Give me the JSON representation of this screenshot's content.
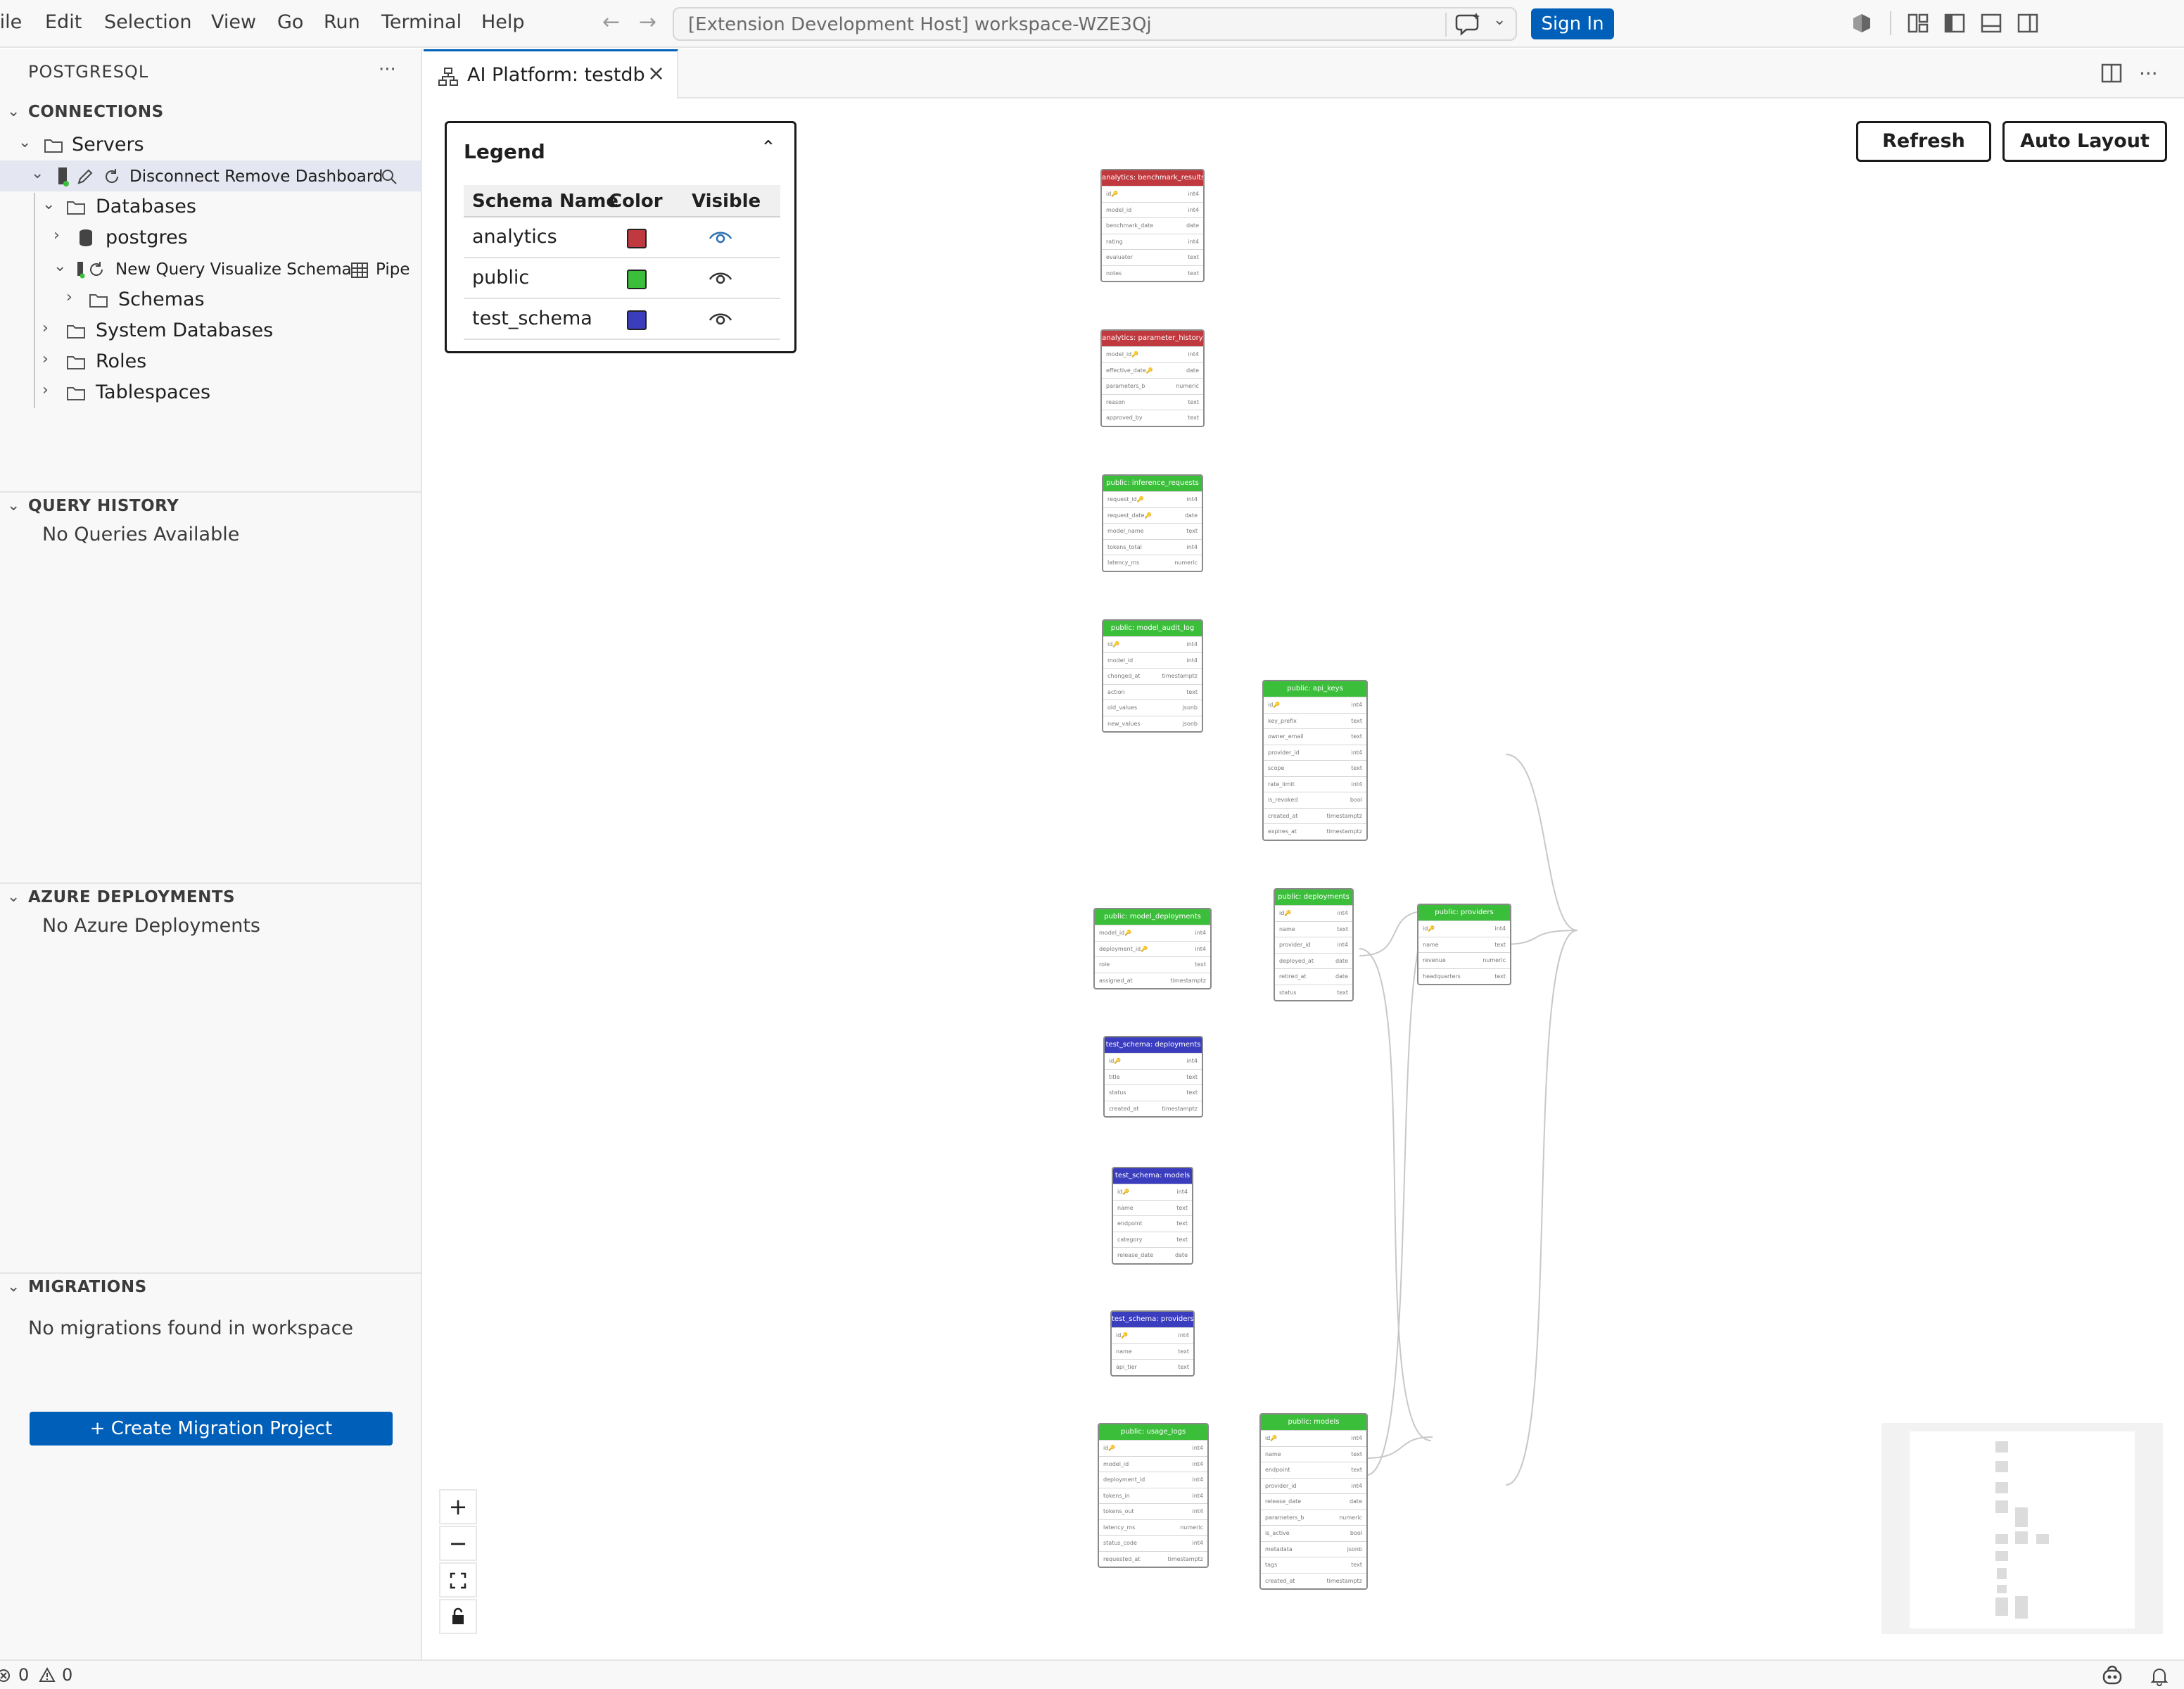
{
  "menu": [
    "File",
    "Edit",
    "Selection",
    "View",
    "Go",
    "Run",
    "Terminal",
    "Help"
  ],
  "command_center": {
    "title": "[Extension Development Host] workspace-WZE3Qj"
  },
  "sign_in": "Sign In",
  "sidebar": {
    "title": "POSTGRESQL",
    "connections": {
      "header": "CONNECTIONS",
      "servers": "Servers",
      "server_actions": "Disconnect Remove Dashboard",
      "databases": "Databases",
      "postgres": "postgres",
      "db_actions": "New Query Visualize Schema",
      "db_actions_more": "Pipe",
      "schemas": "Schemas",
      "system_databases": "System Databases",
      "roles": "Roles",
      "tablespaces": "Tablespaces"
    },
    "query_history": {
      "header": "QUERY HISTORY",
      "empty": "No Queries Available"
    },
    "azure": {
      "header": "AZURE DEPLOYMENTS",
      "empty": "No Azure Deployments"
    },
    "migrations": {
      "header": "MIGRATIONS",
      "empty": "No migrations found in workspace",
      "create": "+ Create Migration Project"
    }
  },
  "tab": {
    "label": "AI Platform: testdb"
  },
  "canvas": {
    "refresh": "Refresh",
    "auto_layout": "Auto Layout"
  },
  "legend": {
    "title": "Legend",
    "headers": {
      "name": "Schema Name",
      "color": "Color",
      "visible": "Visible"
    },
    "rows": [
      {
        "name": "analytics",
        "color": "#c0393f",
        "visible": true
      },
      {
        "name": "public",
        "color": "#3bbf3b",
        "visible": true
      },
      {
        "name": "test_schema",
        "color": "#3b3dbf",
        "visible": true
      }
    ]
  },
  "tables": [
    {
      "title": "analytics: benchmark_results",
      "schema": "analytics",
      "cols": [
        [
          "id🔑",
          "int4"
        ],
        [
          "model_id",
          "int4"
        ],
        [
          "benchmark_date",
          "date"
        ],
        [
          "rating",
          "int4"
        ],
        [
          "evaluator",
          "text"
        ],
        [
          "notes",
          "text"
        ]
      ]
    },
    {
      "title": "analytics: parameter_history",
      "schema": "analytics",
      "cols": [
        [
          "model_id🔑",
          "int4"
        ],
        [
          "effective_date🔑",
          "date"
        ],
        [
          "parameters_b",
          "numeric"
        ],
        [
          "reason",
          "text"
        ],
        [
          "approved_by",
          "text"
        ]
      ]
    },
    {
      "title": "public: inference_requests",
      "schema": "public",
      "cols": [
        [
          "request_id🔑",
          "int4"
        ],
        [
          "request_date🔑",
          "date"
        ],
        [
          "model_name",
          "text"
        ],
        [
          "tokens_total",
          "int4"
        ],
        [
          "latency_ms",
          "numeric"
        ]
      ]
    },
    {
      "title": "public: model_audit_log",
      "schema": "public",
      "cols": [
        [
          "id🔑",
          "int4"
        ],
        [
          "model_id",
          "int4"
        ],
        [
          "changed_at",
          "timestamptz"
        ],
        [
          "action",
          "text"
        ],
        [
          "old_values",
          "jsonb"
        ],
        [
          "new_values",
          "jsonb"
        ]
      ]
    },
    {
      "title": "public: api_keys",
      "schema": "public",
      "cols": [
        [
          "id🔑",
          "int4"
        ],
        [
          "key_prefix",
          "text"
        ],
        [
          "owner_email",
          "text"
        ],
        [
          "provider_id",
          "int4"
        ],
        [
          "scope",
          "text"
        ],
        [
          "rate_limit",
          "int4"
        ],
        [
          "is_revoked",
          "bool"
        ],
        [
          "created_at",
          "timestamptz"
        ],
        [
          "expires_at",
          "timestamptz"
        ]
      ]
    },
    {
      "title": "public: deployments",
      "schema": "public",
      "cols": [
        [
          "id🔑",
          "int4"
        ],
        [
          "name",
          "text"
        ],
        [
          "provider_id",
          "int4"
        ],
        [
          "deployed_at",
          "date"
        ],
        [
          "retired_at",
          "date"
        ],
        [
          "status",
          "text"
        ]
      ]
    },
    {
      "title": "public: providers",
      "schema": "public",
      "cols": [
        [
          "id🔑",
          "int4"
        ],
        [
          "name",
          "text"
        ],
        [
          "revenue",
          "numeric"
        ],
        [
          "headquarters",
          "text"
        ]
      ]
    },
    {
      "title": "public: model_deployments",
      "schema": "public",
      "cols": [
        [
          "model_id🔑",
          "int4"
        ],
        [
          "deployment_id🔑",
          "int4"
        ],
        [
          "role",
          "text"
        ],
        [
          "assigned_at",
          "timestamptz"
        ]
      ]
    },
    {
      "title": "test_schema: deployments",
      "schema": "test_schema",
      "cols": [
        [
          "id🔑",
          "int4"
        ],
        [
          "title",
          "text"
        ],
        [
          "status",
          "text"
        ],
        [
          "created_at",
          "timestamptz"
        ]
      ]
    },
    {
      "title": "test_schema: models",
      "schema": "test_schema",
      "cols": [
        [
          "id🔑",
          "int4"
        ],
        [
          "name",
          "text"
        ],
        [
          "endpoint",
          "text"
        ],
        [
          "category",
          "text"
        ],
        [
          "release_date",
          "date"
        ]
      ]
    },
    {
      "title": "test_schema: providers",
      "schema": "test_schema",
      "cols": [
        [
          "id🔑",
          "int4"
        ],
        [
          "name",
          "text"
        ],
        [
          "api_tier",
          "text"
        ]
      ]
    },
    {
      "title": "public: usage_logs",
      "schema": "public",
      "cols": [
        [
          "id🔑",
          "int4"
        ],
        [
          "model_id",
          "int4"
        ],
        [
          "deployment_id",
          "int4"
        ],
        [
          "tokens_in",
          "int4"
        ],
        [
          "tokens_out",
          "int4"
        ],
        [
          "latency_ms",
          "numeric"
        ],
        [
          "status_code",
          "int4"
        ],
        [
          "requested_at",
          "timestamptz"
        ]
      ]
    },
    {
      "title": "public: models",
      "schema": "public",
      "cols": [
        [
          "id🔑",
          "int4"
        ],
        [
          "name",
          "text"
        ],
        [
          "endpoint",
          "text"
        ],
        [
          "provider_id",
          "int4"
        ],
        [
          "release_date",
          "date"
        ],
        [
          "parameters_b",
          "numeric"
        ],
        [
          "is_active",
          "bool"
        ],
        [
          "metadata",
          "jsonb"
        ],
        [
          "tags",
          "text"
        ],
        [
          "created_at",
          "timestamptz"
        ]
      ]
    }
  ],
  "status": {
    "errors": "0",
    "warnings": "0"
  },
  "icons": [
    "chevron-down-icon",
    "chevron-right-icon",
    "folder-icon",
    "database-icon",
    "server-icon",
    "edit-icon",
    "refresh-icon",
    "search-icon",
    "table-icon",
    "eye-icon",
    "close-icon",
    "more-icon",
    "plus-icon",
    "minus-icon",
    "fit-view-icon",
    "lock-icon",
    "bell-icon",
    "error-icon",
    "warning-icon"
  ]
}
